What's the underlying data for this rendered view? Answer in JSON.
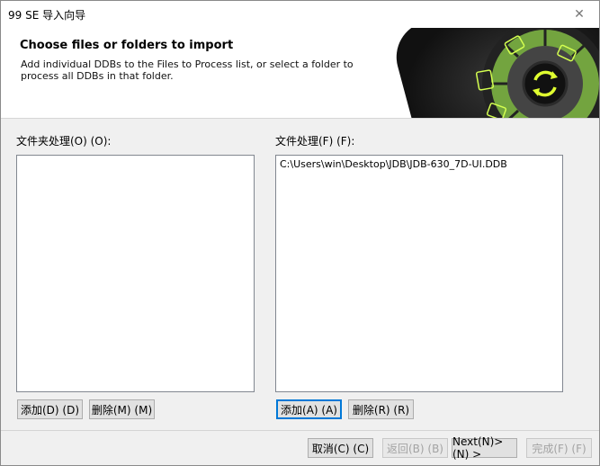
{
  "window": {
    "title": "99 SE 导入向导",
    "close_glyph": "✕"
  },
  "header": {
    "title": "Choose files or folders to import",
    "description": "Add individual DDBs to the Files to Process list, or select a folder to process all DDBs in that folder."
  },
  "folders_panel": {
    "label": "文件夹处理(O) (O):",
    "items": [],
    "add_label": "添加(D) (D)",
    "remove_label": "删除(M) (M)"
  },
  "files_panel": {
    "label": "文件处理(F) (F):",
    "items": [
      "C:\\Users\\win\\Desktop\\JDB\\JDB-630_7D-UI.DDB"
    ],
    "add_label": "添加(A) (A)",
    "remove_label": "删除(R) (R)"
  },
  "footer": {
    "cancel_label": "取消(C) (C)",
    "back_label": "返回(B) (B)",
    "next_label": "Next(N)> (N) >",
    "finish_label": "完成(F) (F)"
  },
  "colors": {
    "accent": "#0078d7",
    "banner_green": "#9acd32"
  }
}
